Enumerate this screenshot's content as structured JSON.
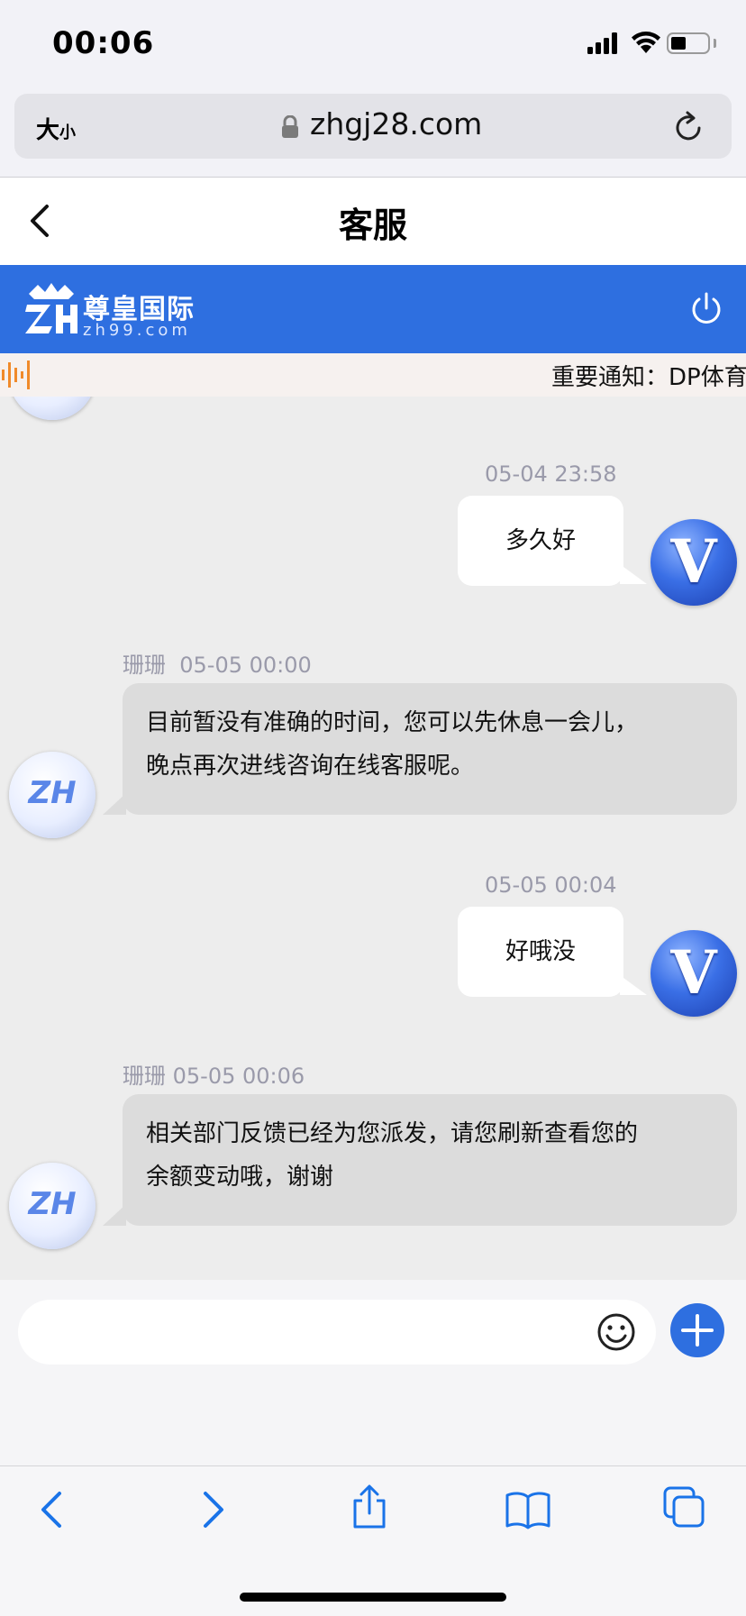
{
  "status_bar": {
    "time": "00:06"
  },
  "address_bar": {
    "size_big": "大",
    "size_small": "小",
    "url": "zhgj28.com"
  },
  "header": {
    "title": "客服"
  },
  "brand": {
    "name": "尊皇国际",
    "domain": "zh99.com"
  },
  "notice": {
    "text": "重要通知：DP体育"
  },
  "chat": {
    "messages": [
      {
        "direction": "out",
        "time": "05-04 23:58",
        "text": "多久好",
        "avatar": "V"
      },
      {
        "direction": "in",
        "sender": "珊珊",
        "time": "05-05 00:00",
        "lines": [
          "目前暂没有准确的时间，您可以先休息一会儿，",
          "晚点再次进线咨询在线客服呢。"
        ],
        "avatar": "ZH"
      },
      {
        "direction": "out",
        "time": "05-05 00:04",
        "text": "好哦没",
        "avatar": "V"
      },
      {
        "direction": "in",
        "sender": "珊珊",
        "time": "05-05 00:06",
        "lines": [
          "相关部门反馈已经为您派发，请您刷新查看您的",
          "余额变动哦，谢谢"
        ],
        "avatar": "ZH"
      }
    ]
  },
  "input": {
    "placeholder": ""
  },
  "colors": {
    "brand_blue": "#2e6fe0",
    "chat_bg": "#ededed",
    "incoming_bubble": "#dcdcdc",
    "ios_blue": "#1a73e8"
  },
  "icons": [
    "lock-icon",
    "reload-icon",
    "back-chevron-icon",
    "power-icon",
    "emoji-icon",
    "plus-icon",
    "toolbar-back-icon",
    "toolbar-forward-icon",
    "share-icon",
    "bookmarks-icon",
    "tabs-icon"
  ]
}
